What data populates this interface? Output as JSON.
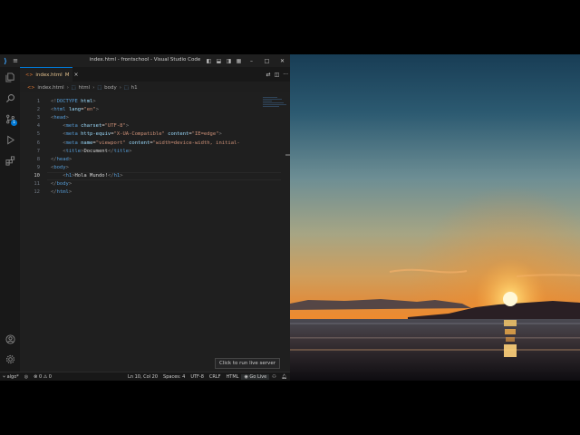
{
  "window": {
    "title": "index.html - frontschool - Visual Studio Code",
    "menu_icon": "hamburger-menu-icon",
    "controls": [
      "toggle-primary-sidebar-icon",
      "toggle-panel-icon",
      "toggle-secondary-sidebar-icon",
      "customize-layout-icon"
    ],
    "window_buttons": {
      "minimize": "–",
      "maximize": "□",
      "close": "✕"
    }
  },
  "activity_bar": {
    "items": [
      "explorer-icon",
      "search-icon",
      "source-control-icon",
      "run-debug-icon",
      "extensions-icon"
    ],
    "source_control_badge": "1",
    "bottom": [
      "account-icon",
      "manage-gear-icon"
    ]
  },
  "tab": {
    "label": "index.html",
    "status": "M"
  },
  "breadcrumb": {
    "items": [
      "index.html",
      "html",
      "body",
      "h1"
    ]
  },
  "editor": {
    "line_numbers": [
      "1",
      "2",
      "3",
      "4",
      "5",
      "6",
      "7",
      "8",
      "9",
      "10",
      "11",
      "12"
    ],
    "active_line": 10,
    "lines": [
      [
        [
          "p",
          "<!"
        ],
        [
          "t",
          "DOCTYPE"
        ],
        [
          "x",
          " "
        ],
        [
          "a",
          "html"
        ],
        [
          "p",
          ">"
        ]
      ],
      [
        [
          "p",
          "<"
        ],
        [
          "t",
          "html"
        ],
        [
          "x",
          " "
        ],
        [
          "a",
          "lang"
        ],
        [
          "x",
          "="
        ],
        [
          "s",
          "\"en\""
        ],
        [
          "p",
          ">"
        ]
      ],
      [
        [
          "p",
          "<"
        ],
        [
          "t",
          "head"
        ],
        [
          "p",
          ">"
        ]
      ],
      [
        [
          "x",
          "    "
        ],
        [
          "p",
          "<"
        ],
        [
          "t",
          "meta"
        ],
        [
          "x",
          " "
        ],
        [
          "a",
          "charset"
        ],
        [
          "x",
          "="
        ],
        [
          "s",
          "\"UTF-8\""
        ],
        [
          "p",
          ">"
        ]
      ],
      [
        [
          "x",
          "    "
        ],
        [
          "p",
          "<"
        ],
        [
          "t",
          "meta"
        ],
        [
          "x",
          " "
        ],
        [
          "a",
          "http-equiv"
        ],
        [
          "x",
          "="
        ],
        [
          "s",
          "\"X-UA-Compatible\""
        ],
        [
          "x",
          " "
        ],
        [
          "a",
          "content"
        ],
        [
          "x",
          "="
        ],
        [
          "s",
          "\"IE=edge\""
        ],
        [
          "p",
          ">"
        ]
      ],
      [
        [
          "x",
          "    "
        ],
        [
          "p",
          "<"
        ],
        [
          "t",
          "meta"
        ],
        [
          "x",
          " "
        ],
        [
          "a",
          "name"
        ],
        [
          "x",
          "="
        ],
        [
          "s",
          "\"viewport\""
        ],
        [
          "x",
          " "
        ],
        [
          "a",
          "content"
        ],
        [
          "x",
          "="
        ],
        [
          "s",
          "\"width=device-width, initial-"
        ]
      ],
      [
        [
          "x",
          "    "
        ],
        [
          "p",
          "<"
        ],
        [
          "t",
          "title"
        ],
        [
          "p",
          ">"
        ],
        [
          "x",
          "Document"
        ],
        [
          "p",
          "</"
        ],
        [
          "t",
          "title"
        ],
        [
          "p",
          ">"
        ]
      ],
      [
        [
          "p",
          "</"
        ],
        [
          "t",
          "head"
        ],
        [
          "p",
          ">"
        ]
      ],
      [
        [
          "p",
          "<"
        ],
        [
          "t",
          "body"
        ],
        [
          "p",
          ">"
        ]
      ],
      [
        [
          "x",
          "    "
        ],
        [
          "p",
          "<"
        ],
        [
          "t",
          "h1"
        ],
        [
          "p",
          ">"
        ],
        [
          "x",
          "Hola Mundo!"
        ],
        [
          "p",
          "</"
        ],
        [
          "t",
          "h1"
        ],
        [
          "p",
          ">"
        ]
      ],
      [
        [
          "p",
          "</"
        ],
        [
          "t",
          "body"
        ],
        [
          "p",
          ">"
        ]
      ],
      [
        [
          "p",
          "</"
        ],
        [
          "t",
          "html"
        ],
        [
          "p",
          ">"
        ]
      ]
    ]
  },
  "statusbar": {
    "branch": "algo*",
    "errors": "0",
    "warnings": "0",
    "position": "Ln 10, Col 20",
    "spaces": "Spaces: 4",
    "encoding": "UTF-8",
    "eol": "CRLF",
    "language": "HTML",
    "go_live": "Go Live"
  },
  "tooltip": "Click to run live server",
  "colors": {
    "accent": "#0078d4",
    "editor_bg": "#1f1f1f",
    "tag": "#569cd6",
    "attr": "#9cdcfe",
    "string": "#ce9178"
  }
}
